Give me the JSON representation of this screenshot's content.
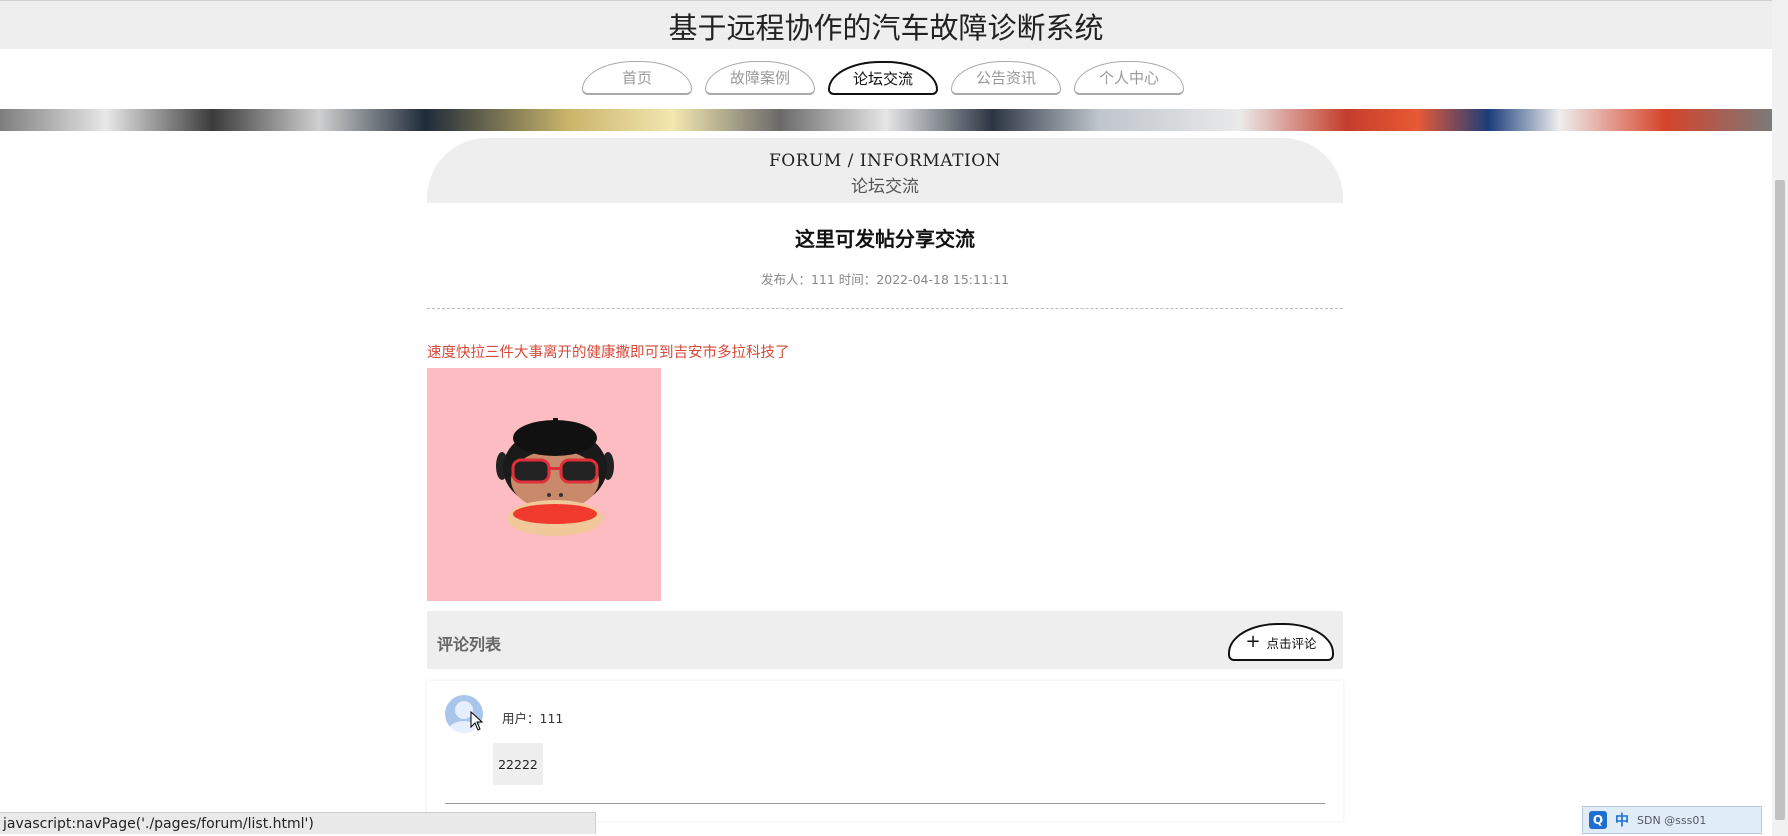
{
  "header": {
    "title": "基于远程协作的汽车故障诊断系统"
  },
  "nav": {
    "items": [
      {
        "label": "首页",
        "active": false
      },
      {
        "label": "故障案例",
        "active": false
      },
      {
        "label": "论坛交流",
        "active": true
      },
      {
        "label": "公告资讯",
        "active": false
      },
      {
        "label": "个人中心",
        "active": false
      }
    ]
  },
  "section": {
    "title_en": "FORUM / INFORMATION",
    "title_cn": "论坛交流"
  },
  "post": {
    "title": "这里可发帖分享交流",
    "meta": "发布人：111 时间：2022-04-18 15:11:11",
    "content": "速度快拉三件大事离开的健康撒即可到吉安市多拉科技了",
    "image_icon": "monkey-sunglasses-image"
  },
  "comments": {
    "title": "评论列表",
    "button_label": "点击评论",
    "items": [
      {
        "user": "用户：111",
        "text": "22222"
      }
    ]
  },
  "statusbar": {
    "text": "javascript:navPage('./pages/forum/list.html')"
  },
  "tray": {
    "q": "Q",
    "lang": "中",
    "text": "SDN @sss01"
  },
  "colors": {
    "accent_red": "#d64a3a",
    "image_bg": "#fdbcc2",
    "header_bg": "#eeeeee"
  }
}
